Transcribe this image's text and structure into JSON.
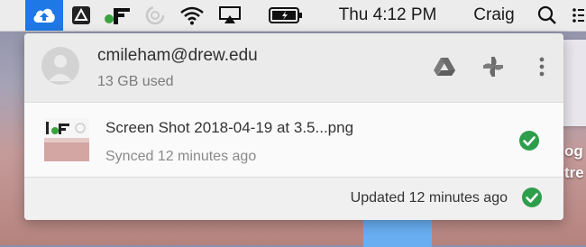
{
  "menubar": {
    "clock": "Thu 4:12 PM",
    "user": "Craig",
    "icons": [
      "backup-upload-icon",
      "google-drive-icon",
      "app-icon",
      "spinner-icon",
      "wifi-icon",
      "airplay-icon",
      "battery-icon",
      "search-icon",
      "list-icon"
    ]
  },
  "desktop": {
    "side_text_1": "og",
    "side_text_2": "tre"
  },
  "account": {
    "email": "cmileham@drew.edu",
    "usage": "13 GB used"
  },
  "activity": [
    {
      "file_name": "Screen Shot 2018-04-19 at 3.5...png",
      "status": "Synced 12 minutes ago"
    }
  ],
  "footer": {
    "status": "Updated 12 minutes ago"
  },
  "colors": {
    "accent_blue": "#1e78e6",
    "success_green": "#2e9e4c"
  }
}
